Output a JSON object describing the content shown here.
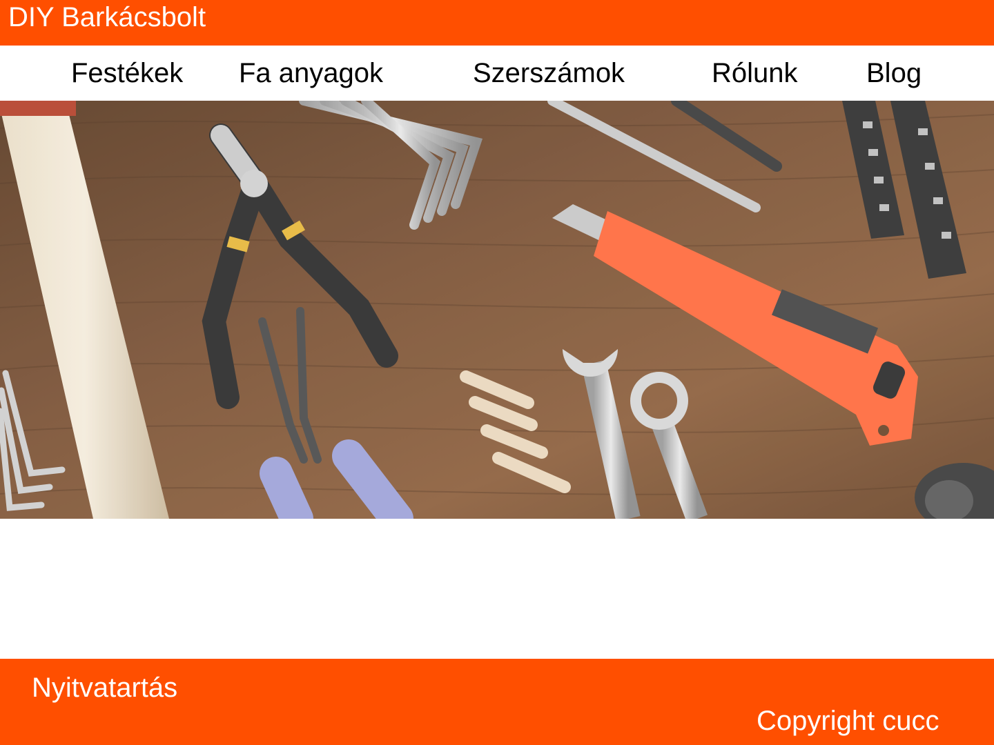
{
  "header": {
    "title": "DIY Barkácsbolt",
    "background_color": "#ff4f00"
  },
  "nav": {
    "items": [
      {
        "label": "Festékek"
      },
      {
        "label": "Fa anyagok"
      },
      {
        "label": "Szerszámok"
      },
      {
        "label": "Rólunk"
      },
      {
        "label": "Blog"
      }
    ]
  },
  "hero": {
    "image_name": "tools-on-wooden-table-photo",
    "tools": [
      "hammer",
      "pliers",
      "hex-keys",
      "screwdriver",
      "utility-knife",
      "drill-bits",
      "wooden-dowels",
      "open-end-wrench",
      "ring-wrench",
      "round-nose-pliers",
      "drill"
    ]
  },
  "footer": {
    "hours_label": "Nyitvatartás",
    "copyright": "Copyright cucc",
    "background_color": "#ff4f00"
  }
}
